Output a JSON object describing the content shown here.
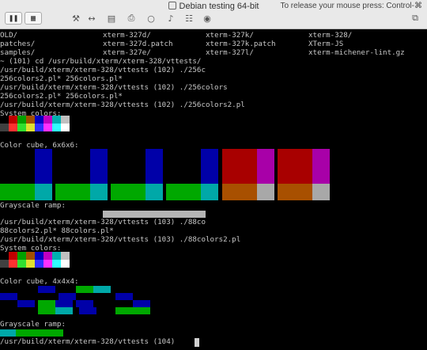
{
  "window": {
    "title": "Debian testing 64-bit",
    "release_hint": "To release your mouse press: Control-⌘"
  },
  "toolbar": {
    "pause_icon": "pause-icon",
    "snapshot_icon": "vm-settings-icon",
    "wrench_icon": "wrench-icon",
    "network_icon": "network-arrows-icon",
    "disk_icon": "hard-disk-icon",
    "printer_icon": "printer-icon",
    "camera_icon": "camera-icon",
    "sound_icon": "speaker-icon",
    "usb_icon": "usb-icon",
    "share_icon": "share-icon",
    "fullscreen_icon": "fullscreen-icon"
  },
  "listing": [
    [
      "OLD/",
      "xterm-327d/",
      "xterm-327k/",
      "xterm-328/"
    ],
    [
      "patches/",
      "xterm-327d.patch",
      "xterm-327k.patch",
      "XTerm-JS"
    ],
    [
      "samples/",
      "xterm-327e/",
      "xterm-327l/",
      "xterm-michener-lint.gz"
    ]
  ],
  "lines": {
    "l4": "~ (101) cd /usr/build/xterm/xterm-328/vttests/",
    "l5": "/usr/build/xterm/xterm-328/vttests (102) ./256c",
    "l6": "256colors2.pl* 256colors.pl*",
    "l7": "/usr/build/xterm/xterm-328/vttests (102) ./256colors",
    "l8": "256colors2.pl* 256colors.pl*",
    "l9": "/usr/build/xterm/xterm-328/vttests (102) ./256colors2.pl",
    "l10": "System colors:",
    "l12": "Color cube, 6x6x6:",
    "l18": "Grayscale ramp:",
    "l20": "/usr/build/xterm/xterm-328/vttests (103) ./88co",
    "l21": "88colors2.pl* 88colors.pl*",
    "l22": "/usr/build/xterm/xterm-328/vttests (103) ./88colors2.pl",
    "l23": "System colors:",
    "l26": "Color cube, 4x4x4:",
    "l33": "Grayscale ramp:",
    "l35": "/usr/build/xterm/xterm-328/vttests (104)"
  },
  "colors": {
    "system_row1": [
      "#000000",
      "#c00000",
      "#00a000",
      "#a05000",
      "#0000c0",
      "#c000c0",
      "#00b0b0",
      "#c0c0c0"
    ],
    "system_row2": [
      "#404040",
      "#ff3030",
      "#30e030",
      "#e0e030",
      "#3030ff",
      "#ff30ff",
      "#30ffff",
      "#ffffff"
    ],
    "cube_blue": "#0000a8",
    "cube_green": "#00a800",
    "cube_cyan": "#00a8a8",
    "cube_red": "#a80000",
    "cube_magenta": "#a800a8",
    "cube_orange": "#a85000",
    "cube_gray": "#a8a8a8",
    "gray_ramp": "#b4b4b4"
  }
}
